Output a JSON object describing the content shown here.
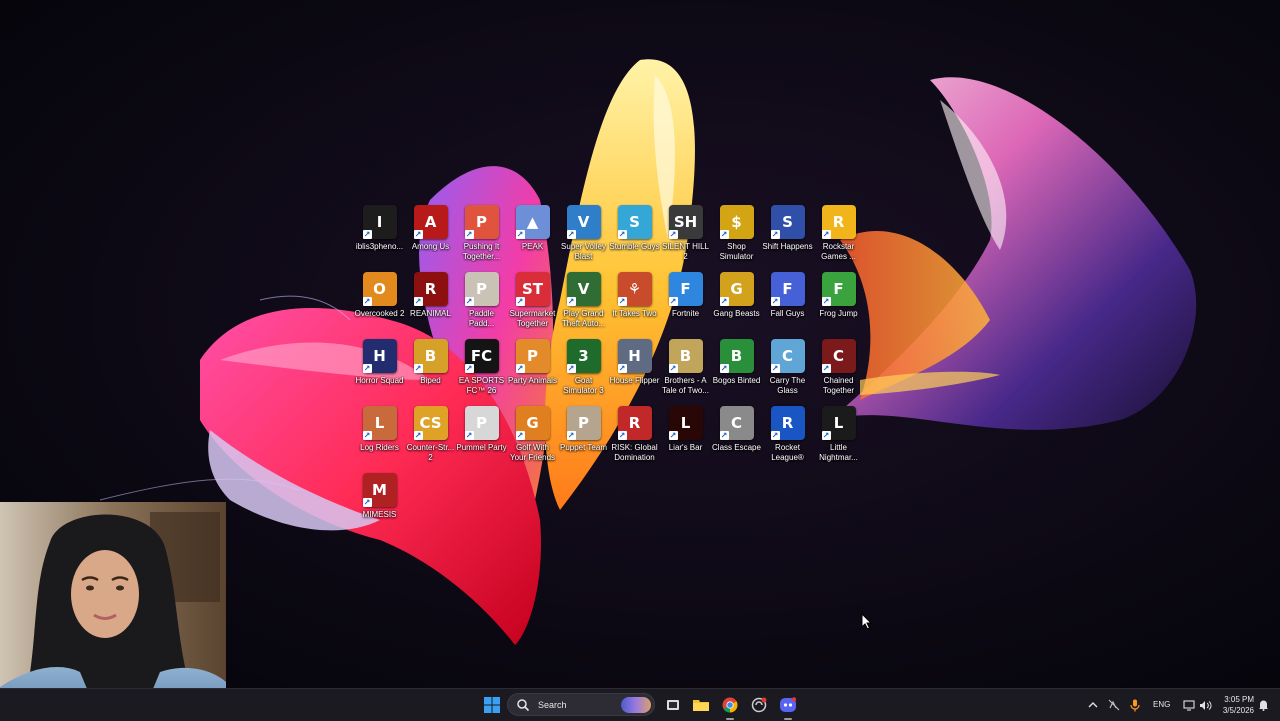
{
  "desktop": {
    "icons": [
      {
        "label": "iblis3pheno...",
        "bg": "#1d1d1d",
        "glyph": "I"
      },
      {
        "label": "Among Us",
        "bg": "#b81919",
        "glyph": "A"
      },
      {
        "label": "Pushing It Together...",
        "bg": "#e0533d",
        "glyph": "P"
      },
      {
        "label": "PEAK",
        "bg": "#6d8fd8",
        "glyph": "▲"
      },
      {
        "label": "Super Volley Blast",
        "bg": "#2f7ec9",
        "glyph": "V"
      },
      {
        "label": "Stumble Guys",
        "bg": "#34a7d6",
        "glyph": "S"
      },
      {
        "label": "SILENT HILL 2",
        "bg": "#3a3a3a",
        "glyph": "SH"
      },
      {
        "label": "Shop Simulator",
        "bg": "#d3a514",
        "glyph": "$"
      },
      {
        "label": "Shift Happens",
        "bg": "#2f4fa8",
        "glyph": "S"
      },
      {
        "label": "Rockstar Games ...",
        "bg": "#f1b51b",
        "glyph": "R"
      },
      {
        "label": "Overcooked 2",
        "bg": "#e28a1d",
        "glyph": "O"
      },
      {
        "label": "REANIMAL",
        "bg": "#8c1010",
        "glyph": "R"
      },
      {
        "label": "Paddle Padd...",
        "bg": "#c9c2b5",
        "glyph": "P"
      },
      {
        "label": "Supermarket Together",
        "bg": "#d92d3a",
        "glyph": "ST"
      },
      {
        "label": "Play Grand Theft Auto...",
        "bg": "#2f6d35",
        "glyph": "V"
      },
      {
        "label": "It Takes Two",
        "bg": "#c84b2b",
        "glyph": "⚘"
      },
      {
        "label": "Fortnite",
        "bg": "#2e86de",
        "glyph": "F"
      },
      {
        "label": "Gang Beasts",
        "bg": "#d2a21d",
        "glyph": "G"
      },
      {
        "label": "Fall Guys",
        "bg": "#4660d8",
        "glyph": "F"
      },
      {
        "label": "Frog Jump",
        "bg": "#3aa33e",
        "glyph": "F"
      },
      {
        "label": "Horror Squad",
        "bg": "#232c6e",
        "glyph": "H"
      },
      {
        "label": "Biped",
        "bg": "#d6a128",
        "glyph": "B"
      },
      {
        "label": "EA SPORTS FC™ 26",
        "bg": "#141414",
        "glyph": "FC"
      },
      {
        "label": "Party Animals",
        "bg": "#e38a2b",
        "glyph": "P"
      },
      {
        "label": "Goat Simulator 3",
        "bg": "#1e6b2c",
        "glyph": "3"
      },
      {
        "label": "House Flipper",
        "bg": "#5f6b82",
        "glyph": "H"
      },
      {
        "label": "Brothers - A Tale of Two...",
        "bg": "#c1a55b",
        "glyph": "B"
      },
      {
        "label": "Bogos Binted",
        "bg": "#2a8f3a",
        "glyph": "B"
      },
      {
        "label": "Carry The Glass",
        "bg": "#5fa6d6",
        "glyph": "C"
      },
      {
        "label": "Chained Together",
        "bg": "#7a1a1a",
        "glyph": "C"
      },
      {
        "label": "Log Riders",
        "bg": "#c86a3c",
        "glyph": "L"
      },
      {
        "label": "Counter-Str... 2",
        "bg": "#e0a127",
        "glyph": "CS"
      },
      {
        "label": "Pummel Party",
        "bg": "#d7d7d7",
        "glyph": "P"
      },
      {
        "label": "Golf With Your Friends",
        "bg": "#e07f1f",
        "glyph": "G"
      },
      {
        "label": "Puppet Team",
        "bg": "#b5a58e",
        "glyph": "P"
      },
      {
        "label": "RISK: Global Domination",
        "bg": "#c0282a",
        "glyph": "R"
      },
      {
        "label": "Liar's Bar",
        "bg": "#2a0707",
        "glyph": "L"
      },
      {
        "label": "Class Escape",
        "bg": "#8a8a8a",
        "glyph": "C"
      },
      {
        "label": "Rocket League®",
        "bg": "#1a55c4",
        "glyph": "R"
      },
      {
        "label": "Little Nightmar...",
        "bg": "#1b1b1b",
        "glyph": "L"
      },
      {
        "label": "MIMESIS",
        "bg": "#b02222",
        "glyph": "M"
      }
    ]
  },
  "taskbar": {
    "search_label": "Search",
    "language": "ENG",
    "time": "3:05 PM",
    "date": "3/5/2026"
  },
  "colors": {
    "taskbar_bg": "#1b1a21",
    "start_blue": "#3aa0f3",
    "folder_yellow": "#f2c230"
  }
}
